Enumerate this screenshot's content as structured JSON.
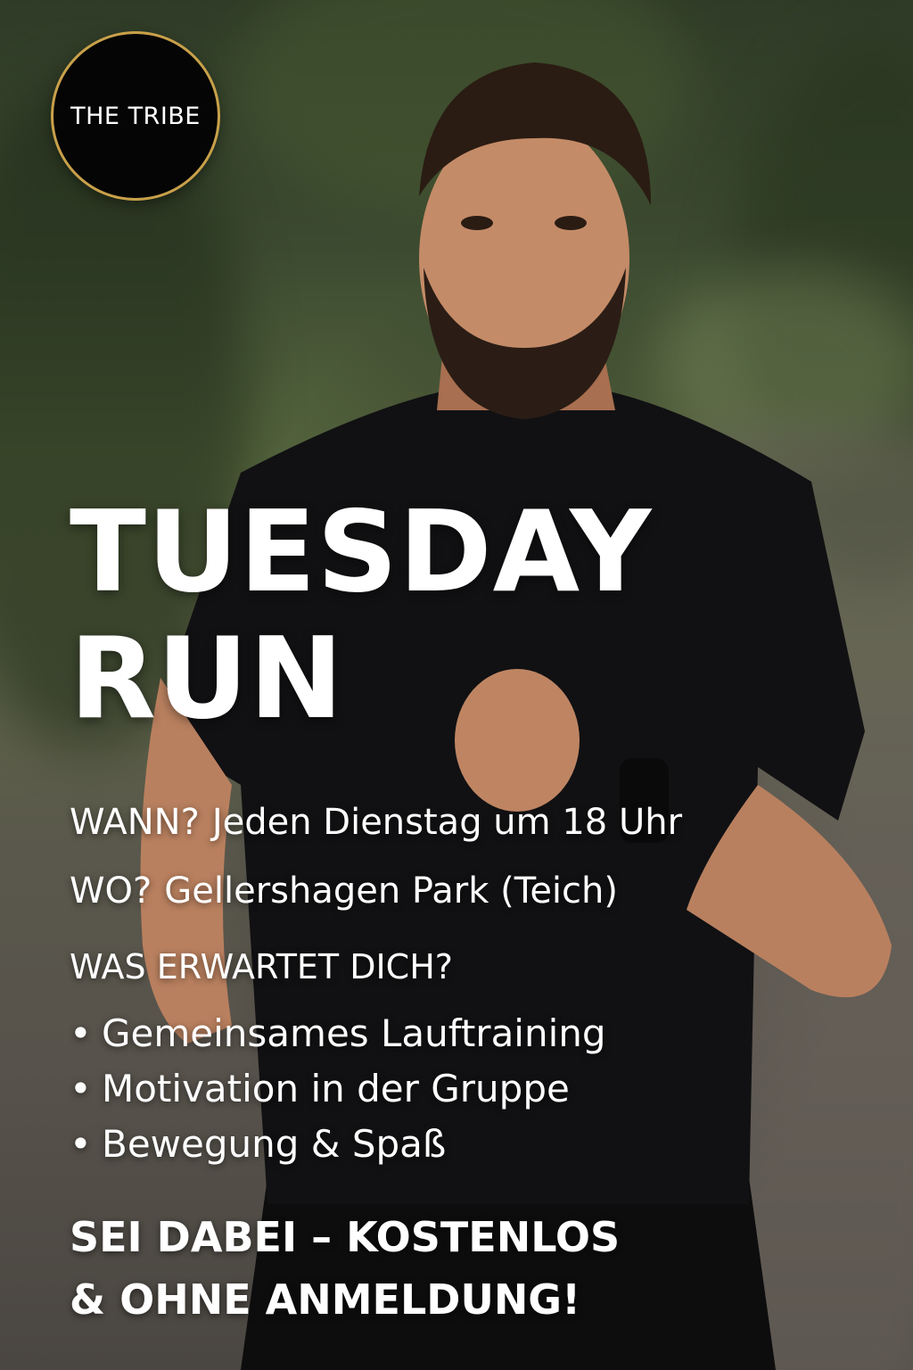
{
  "logo": {
    "text": "THE TRIBE",
    "ring_color": "#c9a14a"
  },
  "headline": {
    "line1": "TUESDAY",
    "line2": "RUN"
  },
  "when": {
    "label": "WANN?",
    "value": "Jeden Dienstag um 18 Uhr"
  },
  "where": {
    "label": "WO?",
    "value": "Gellershagen Park (Teich)"
  },
  "expect": {
    "title": "WAS ERWARTET DICH?",
    "items": [
      "Gemeinsames Lauftraining",
      "Motivation in der Gruppe",
      "Bewegung & Spaß"
    ]
  },
  "cta": {
    "line1": "SEI DABEI – KOSTENLOS",
    "line2": "& OHNE ANMELDUNG!"
  }
}
